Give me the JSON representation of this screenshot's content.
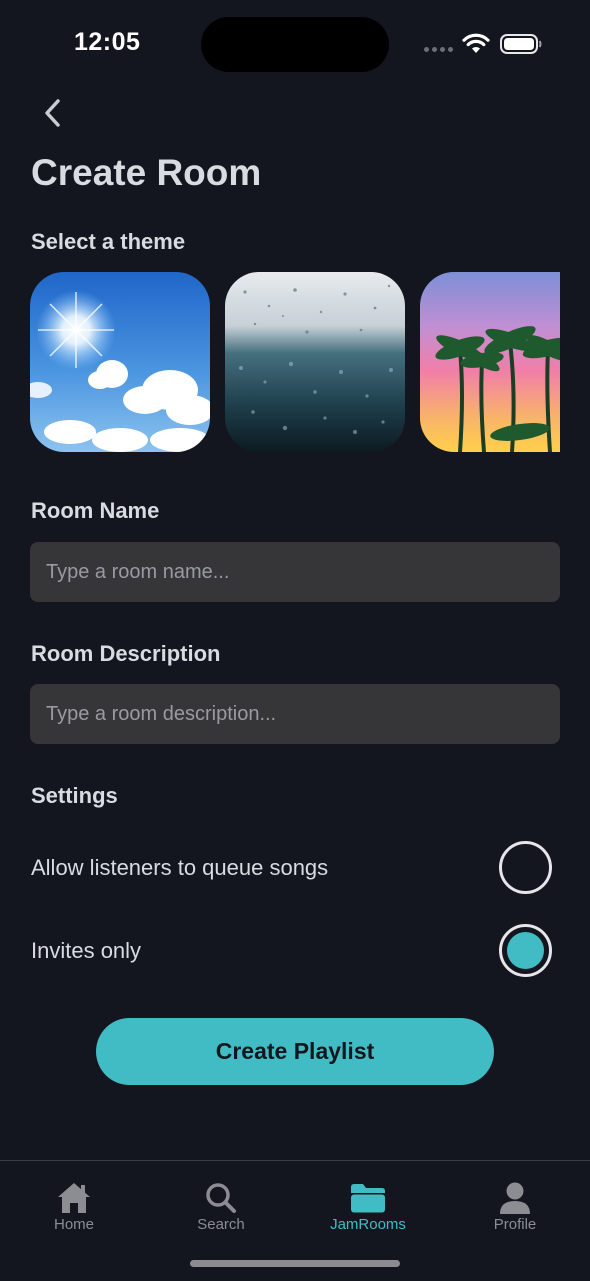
{
  "status_bar": {
    "time": "12:05"
  },
  "header": {
    "title": "Create Room",
    "back_icon": "chevron-left-icon"
  },
  "theme_section": {
    "label": "Select a theme",
    "themes": [
      {
        "name": "sunny-sky"
      },
      {
        "name": "rainy-window"
      },
      {
        "name": "palm-sunset"
      }
    ]
  },
  "room_name": {
    "label": "Room Name",
    "placeholder": "Type a room name...",
    "value": ""
  },
  "room_description": {
    "label": "Room Description",
    "placeholder": "Type a room description...",
    "value": ""
  },
  "settings": {
    "label": "Settings",
    "options": [
      {
        "label": "Allow listeners to queue songs",
        "selected": false
      },
      {
        "label": "Invites only",
        "selected": true
      }
    ]
  },
  "create_button": {
    "label": "Create Playlist"
  },
  "tab_bar": {
    "items": [
      {
        "label": "Home",
        "icon": "home-icon",
        "active": false
      },
      {
        "label": "Search",
        "icon": "search-icon",
        "active": false
      },
      {
        "label": "JamRooms",
        "icon": "folder-icon",
        "active": true
      },
      {
        "label": "Profile",
        "icon": "person-icon",
        "active": false
      }
    ]
  },
  "colors": {
    "background": "#13161f",
    "accent": "#42bcc4",
    "field": "#363638",
    "text": "#d8dbdf",
    "muted": "#8b8d93"
  }
}
